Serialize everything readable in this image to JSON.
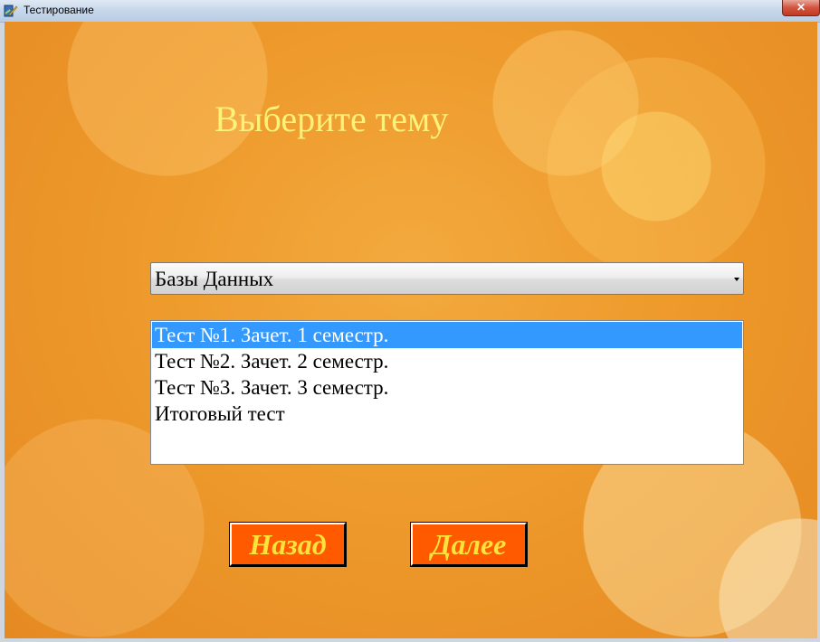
{
  "window": {
    "title": "Тестирование",
    "close_glyph": "✕",
    "app_icon": "app-icon"
  },
  "heading": "Выберите тему",
  "subject_combo": {
    "value": "Базы Данных",
    "arrow_icon": "dropdown-arrow-icon"
  },
  "tests_list": {
    "items": [
      {
        "label": "Тест №1. Зачет. 1 семестр.",
        "selected": true
      },
      {
        "label": "Тест №2. Зачет. 2 семестр.",
        "selected": false
      },
      {
        "label": "Тест №3. Зачет. 3 семестр.",
        "selected": false
      },
      {
        "label": "Итоговый тест",
        "selected": false
      }
    ]
  },
  "buttons": {
    "back_label": "Назад",
    "next_label": "Далее"
  },
  "colors": {
    "background": "#ee9a2c",
    "heading_text": "#fbf279",
    "button_bg": "#ff5a00",
    "button_text": "#ffe23a",
    "selection": "#3399ff"
  }
}
